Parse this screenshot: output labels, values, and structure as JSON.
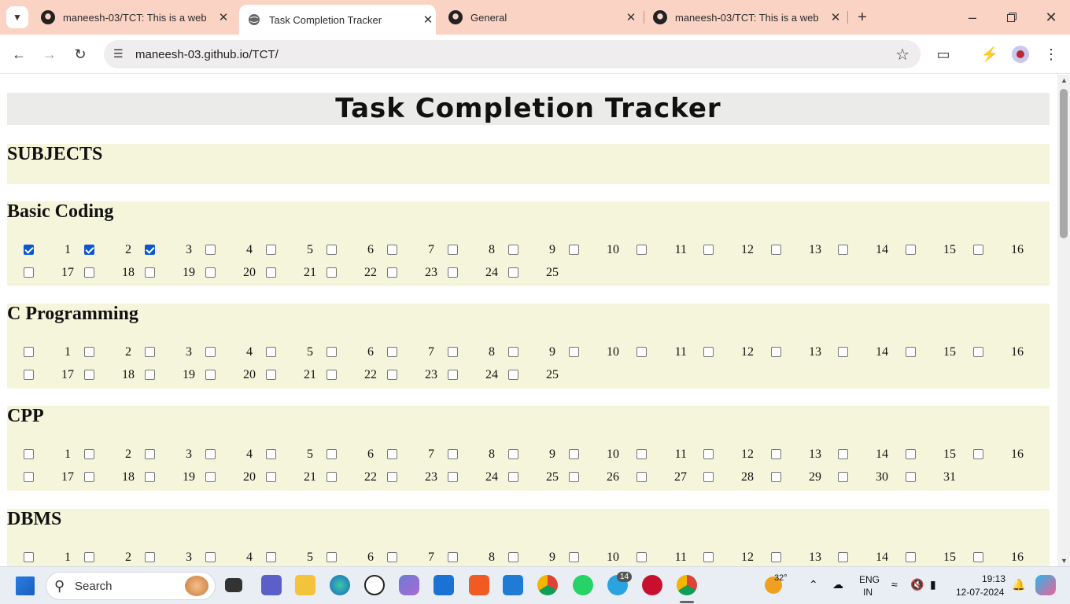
{
  "browser": {
    "tabs": [
      {
        "title": "maneesh-03/TCT: This is a web",
        "active": false
      },
      {
        "title": "Task Completion Tracker",
        "active": true
      },
      {
        "title": "General",
        "active": false
      },
      {
        "title": "maneesh-03/TCT: This is a web",
        "active": false
      }
    ],
    "url": "maneesh-03.github.io/TCT/",
    "window_controls": [
      "minimize",
      "restore",
      "close"
    ]
  },
  "page": {
    "title": "Task Completion Tracker",
    "sections_header": "SUBJECTS",
    "subjects": [
      {
        "name": "Basic Coding",
        "count": 25,
        "checked": [
          1,
          2,
          3
        ]
      },
      {
        "name": "C Programming",
        "count": 25,
        "checked": []
      },
      {
        "name": "CPP",
        "count": 31,
        "checked": []
      },
      {
        "name": "DBMS",
        "count": 16,
        "checked": []
      }
    ]
  },
  "taskbar": {
    "search_placeholder": "Search",
    "weather": "32°",
    "language_top": "ENG",
    "language_bottom": "IN",
    "time": "19:13",
    "date": "12-07-2024",
    "telegram_badge": "14",
    "apps": [
      "start-icon",
      "search-icon",
      "task-view-icon",
      "teams-icon",
      "file-explorer-icon",
      "edge-icon",
      "dell-icon",
      "copilot-icon",
      "mail-icon",
      "brave-icon",
      "vscode-icon",
      "chrome-icon",
      "whatsapp-icon",
      "telegram-icon",
      "devcpp-icon",
      "chrome-profile-icon"
    ]
  }
}
